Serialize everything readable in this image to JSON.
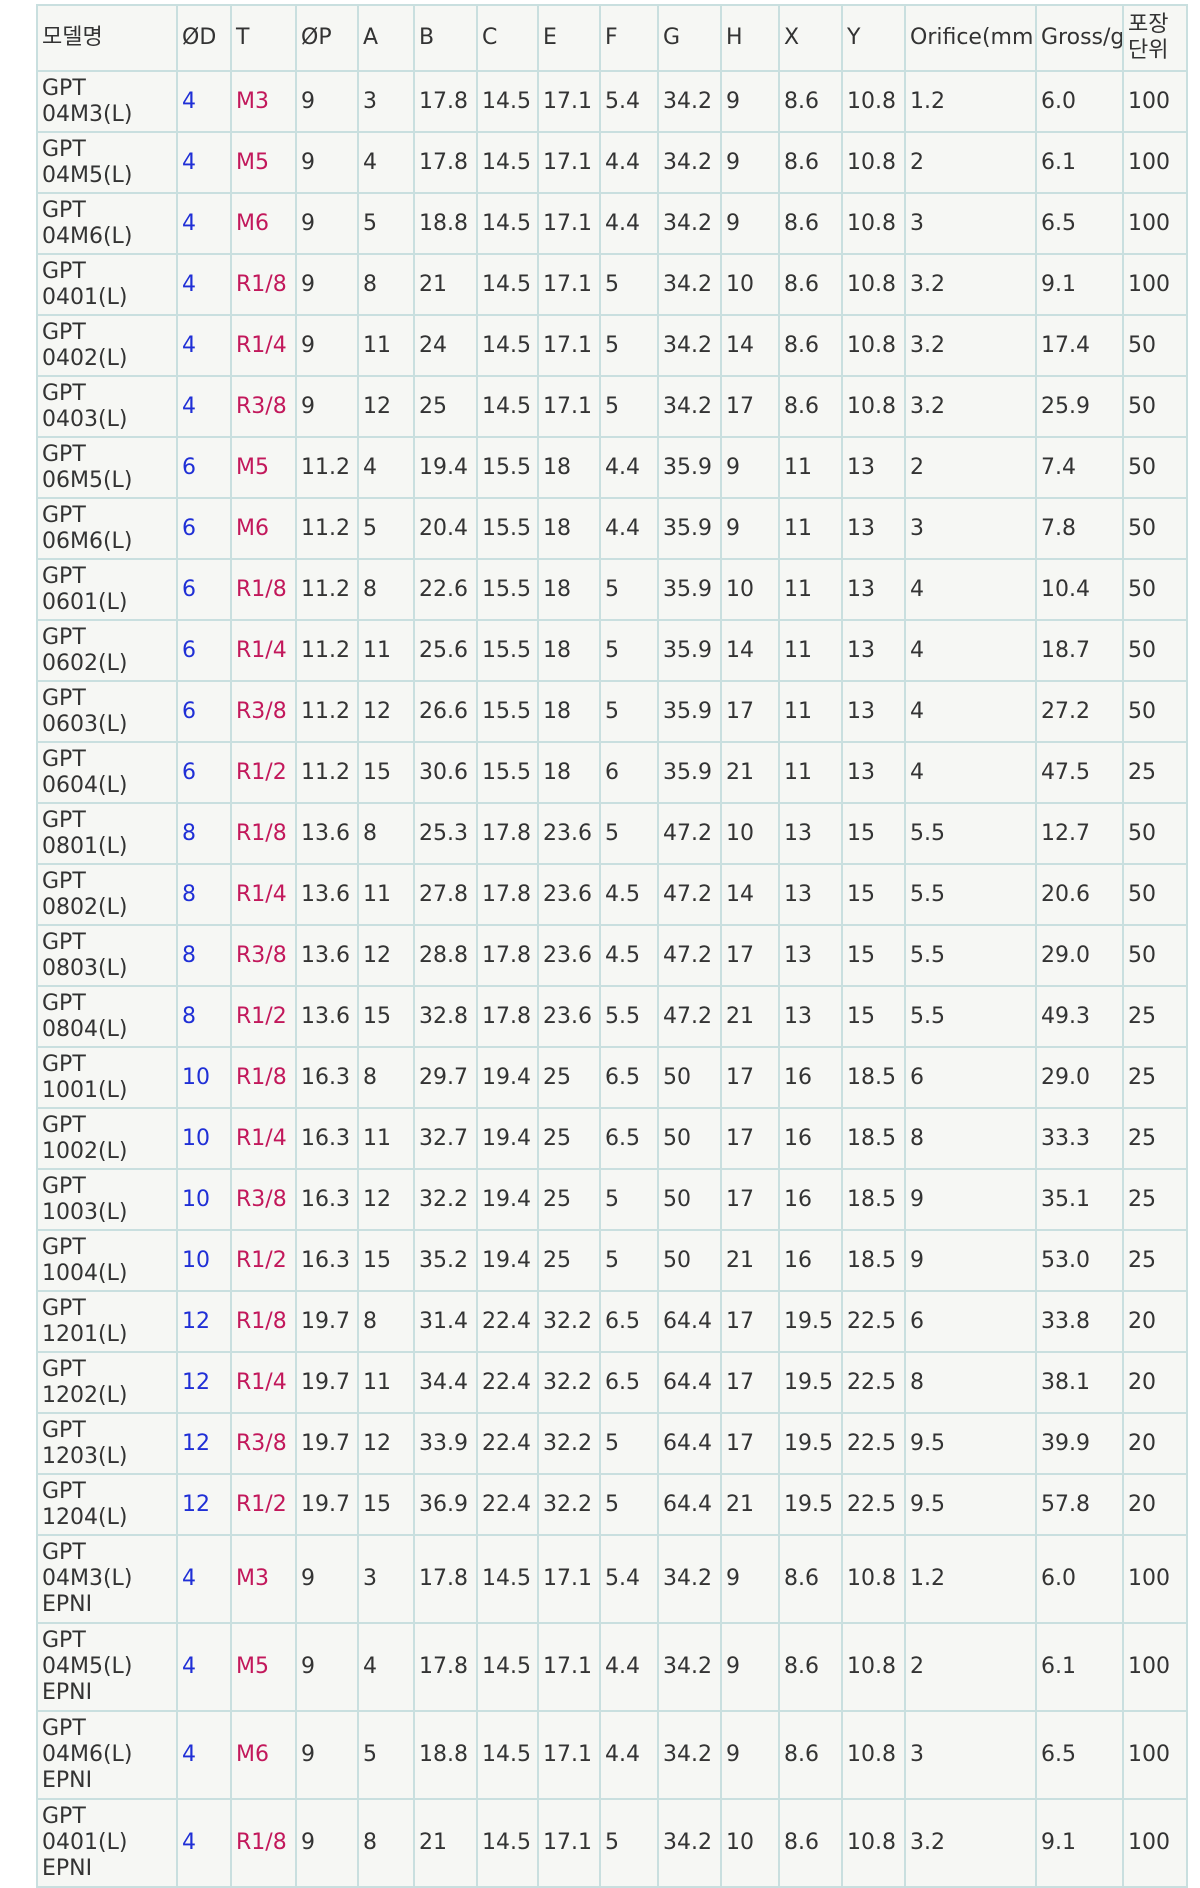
{
  "headers": [
    "모델명",
    "ØD",
    "T",
    "ØP",
    "A",
    "B",
    "C",
    "E",
    "F",
    "G",
    "H",
    "X",
    "Y",
    "Orifice(mm)",
    "Gross/g",
    "포장\n단위"
  ],
  "colors": {
    "od_text": "#1f2fd6",
    "thread_text": "#c2185b",
    "grid_border": "#c9dfdf",
    "cell_background": "#f6f7f4",
    "body_text": "#333333"
  },
  "rows": [
    [
      "GPT\n04M3(L)",
      "4",
      "M3",
      "9",
      "3",
      "17.8",
      "14.5",
      "17.1",
      "5.4",
      "34.2",
      "9",
      "8.6",
      "10.8",
      "1.2",
      "6.0",
      "100"
    ],
    [
      "GPT\n04M5(L)",
      "4",
      "M5",
      "9",
      "4",
      "17.8",
      "14.5",
      "17.1",
      "4.4",
      "34.2",
      "9",
      "8.6",
      "10.8",
      "2",
      "6.1",
      "100"
    ],
    [
      "GPT\n04M6(L)",
      "4",
      "M6",
      "9",
      "5",
      "18.8",
      "14.5",
      "17.1",
      "4.4",
      "34.2",
      "9",
      "8.6",
      "10.8",
      "3",
      "6.5",
      "100"
    ],
    [
      "GPT\n0401(L)",
      "4",
      "R1/8",
      "9",
      "8",
      "21",
      "14.5",
      "17.1",
      "5",
      "34.2",
      "10",
      "8.6",
      "10.8",
      "3.2",
      "9.1",
      "100"
    ],
    [
      "GPT\n0402(L)",
      "4",
      "R1/4",
      "9",
      "11",
      "24",
      "14.5",
      "17.1",
      "5",
      "34.2",
      "14",
      "8.6",
      "10.8",
      "3.2",
      "17.4",
      "50"
    ],
    [
      "GPT\n0403(L)",
      "4",
      "R3/8",
      "9",
      "12",
      "25",
      "14.5",
      "17.1",
      "5",
      "34.2",
      "17",
      "8.6",
      "10.8",
      "3.2",
      "25.9",
      "50"
    ],
    [
      "GPT\n06M5(L)",
      "6",
      "M5",
      "11.2",
      "4",
      "19.4",
      "15.5",
      "18",
      "4.4",
      "35.9",
      "9",
      "11",
      "13",
      "2",
      "7.4",
      "50"
    ],
    [
      "GPT\n06M6(L)",
      "6",
      "M6",
      "11.2",
      "5",
      "20.4",
      "15.5",
      "18",
      "4.4",
      "35.9",
      "9",
      "11",
      "13",
      "3",
      "7.8",
      "50"
    ],
    [
      "GPT\n0601(L)",
      "6",
      "R1/8",
      "11.2",
      "8",
      "22.6",
      "15.5",
      "18",
      "5",
      "35.9",
      "10",
      "11",
      "13",
      "4",
      "10.4",
      "50"
    ],
    [
      "GPT\n0602(L)",
      "6",
      "R1/4",
      "11.2",
      "11",
      "25.6",
      "15.5",
      "18",
      "5",
      "35.9",
      "14",
      "11",
      "13",
      "4",
      "18.7",
      "50"
    ],
    [
      "GPT\n0603(L)",
      "6",
      "R3/8",
      "11.2",
      "12",
      "26.6",
      "15.5",
      "18",
      "5",
      "35.9",
      "17",
      "11",
      "13",
      "4",
      "27.2",
      "50"
    ],
    [
      "GPT\n0604(L)",
      "6",
      "R1/2",
      "11.2",
      "15",
      "30.6",
      "15.5",
      "18",
      "6",
      "35.9",
      "21",
      "11",
      "13",
      "4",
      "47.5",
      "25"
    ],
    [
      "GPT\n0801(L)",
      "8",
      "R1/8",
      "13.6",
      "8",
      "25.3",
      "17.8",
      "23.6",
      "5",
      "47.2",
      "10",
      "13",
      "15",
      "5.5",
      "12.7",
      "50"
    ],
    [
      "GPT\n0802(L)",
      "8",
      "R1/4",
      "13.6",
      "11",
      "27.8",
      "17.8",
      "23.6",
      "4.5",
      "47.2",
      "14",
      "13",
      "15",
      "5.5",
      "20.6",
      "50"
    ],
    [
      "GPT\n0803(L)",
      "8",
      "R3/8",
      "13.6",
      "12",
      "28.8",
      "17.8",
      "23.6",
      "4.5",
      "47.2",
      "17",
      "13",
      "15",
      "5.5",
      "29.0",
      "50"
    ],
    [
      "GPT\n0804(L)",
      "8",
      "R1/2",
      "13.6",
      "15",
      "32.8",
      "17.8",
      "23.6",
      "5.5",
      "47.2",
      "21",
      "13",
      "15",
      "5.5",
      "49.3",
      "25"
    ],
    [
      "GPT\n1001(L)",
      "10",
      "R1/8",
      "16.3",
      "8",
      "29.7",
      "19.4",
      "25",
      "6.5",
      "50",
      "17",
      "16",
      "18.5",
      "6",
      "29.0",
      "25"
    ],
    [
      "GPT\n1002(L)",
      "10",
      "R1/4",
      "16.3",
      "11",
      "32.7",
      "19.4",
      "25",
      "6.5",
      "50",
      "17",
      "16",
      "18.5",
      "8",
      "33.3",
      "25"
    ],
    [
      "GPT\n1003(L)",
      "10",
      "R3/8",
      "16.3",
      "12",
      "32.2",
      "19.4",
      "25",
      "5",
      "50",
      "17",
      "16",
      "18.5",
      "9",
      "35.1",
      "25"
    ],
    [
      "GPT\n1004(L)",
      "10",
      "R1/2",
      "16.3",
      "15",
      "35.2",
      "19.4",
      "25",
      "5",
      "50",
      "21",
      "16",
      "18.5",
      "9",
      "53.0",
      "25"
    ],
    [
      "GPT\n1201(L)",
      "12",
      "R1/8",
      "19.7",
      "8",
      "31.4",
      "22.4",
      "32.2",
      "6.5",
      "64.4",
      "17",
      "19.5",
      "22.5",
      "6",
      "33.8",
      "20"
    ],
    [
      "GPT\n1202(L)",
      "12",
      "R1/4",
      "19.7",
      "11",
      "34.4",
      "22.4",
      "32.2",
      "6.5",
      "64.4",
      "17",
      "19.5",
      "22.5",
      "8",
      "38.1",
      "20"
    ],
    [
      "GPT\n1203(L)",
      "12",
      "R3/8",
      "19.7",
      "12",
      "33.9",
      "22.4",
      "32.2",
      "5",
      "64.4",
      "17",
      "19.5",
      "22.5",
      "9.5",
      "39.9",
      "20"
    ],
    [
      "GPT\n1204(L)",
      "12",
      "R1/2",
      "19.7",
      "15",
      "36.9",
      "22.4",
      "32.2",
      "5",
      "64.4",
      "21",
      "19.5",
      "22.5",
      "9.5",
      "57.8",
      "20"
    ],
    [
      "GPT\n04M3(L)\nEPNI",
      "4",
      "M3",
      "9",
      "3",
      "17.8",
      "14.5",
      "17.1",
      "5.4",
      "34.2",
      "9",
      "8.6",
      "10.8",
      "1.2",
      "6.0",
      "100"
    ],
    [
      "GPT\n04M5(L)\nEPNI",
      "4",
      "M5",
      "9",
      "4",
      "17.8",
      "14.5",
      "17.1",
      "4.4",
      "34.2",
      "9",
      "8.6",
      "10.8",
      "2",
      "6.1",
      "100"
    ],
    [
      "GPT\n04M6(L)\nEPNI",
      "4",
      "M6",
      "9",
      "5",
      "18.8",
      "14.5",
      "17.1",
      "4.4",
      "34.2",
      "9",
      "8.6",
      "10.8",
      "3",
      "6.5",
      "100"
    ],
    [
      "GPT\n0401(L)\nEPNI",
      "4",
      "R1/8",
      "9",
      "8",
      "21",
      "14.5",
      "17.1",
      "5",
      "34.2",
      "10",
      "8.6",
      "10.8",
      "3.2",
      "9.1",
      "100"
    ]
  ]
}
